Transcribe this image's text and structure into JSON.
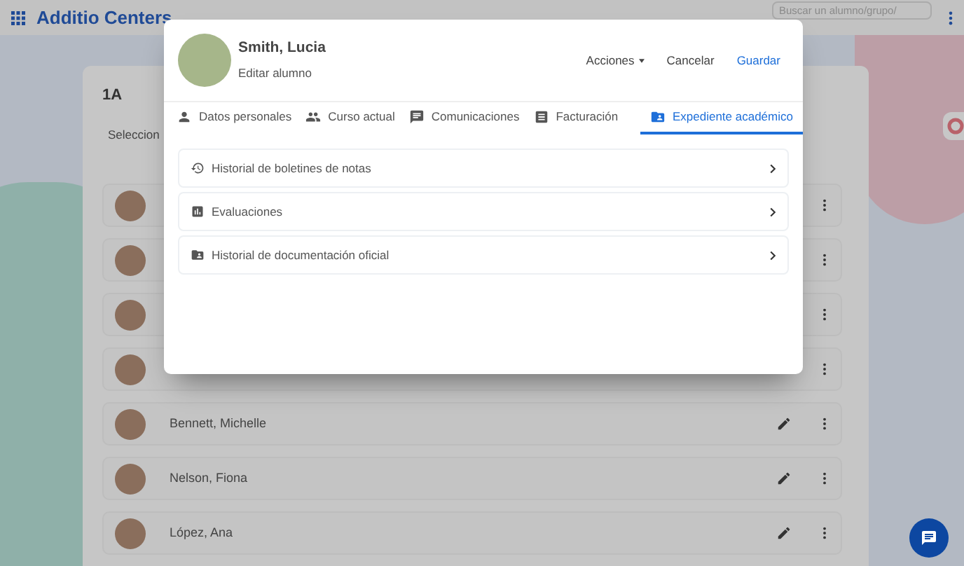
{
  "app": {
    "title": "Additio Centers",
    "search": {
      "placeholder": "Buscar un alumno/grupo/"
    }
  },
  "group": {
    "title": "1A",
    "select_label": "Seleccion"
  },
  "students": [
    {
      "kind": "covered"
    },
    {
      "kind": "covered"
    },
    {
      "kind": "covered"
    },
    {
      "kind": "covered"
    },
    {
      "kind": "named",
      "name": "Bennett, Michelle"
    },
    {
      "kind": "named",
      "name": "Nelson, Fiona"
    },
    {
      "kind": "named",
      "name": "López, Ana"
    }
  ],
  "dialog": {
    "name": "Smith, Lucia",
    "subtitle": "Editar alumno",
    "actions": [
      {
        "label": "Acciones",
        "kind": "menu"
      },
      {
        "label": "Cancelar",
        "kind": "plain"
      },
      {
        "label": "Guardar",
        "kind": "primary"
      }
    ],
    "tabs": [
      {
        "label": "Datos personales",
        "selected": false
      },
      {
        "label": "Curso actual",
        "selected": false
      },
      {
        "label": "Comunicaciones",
        "selected": false
      },
      {
        "label": "Facturación",
        "selected": false
      },
      {
        "label": "Expediente académico",
        "selected": true
      }
    ],
    "items": [
      {
        "label": "Historial de boletines de notas"
      },
      {
        "label": "Evaluaciones"
      },
      {
        "label": "Historial de documentación oficial"
      }
    ]
  }
}
